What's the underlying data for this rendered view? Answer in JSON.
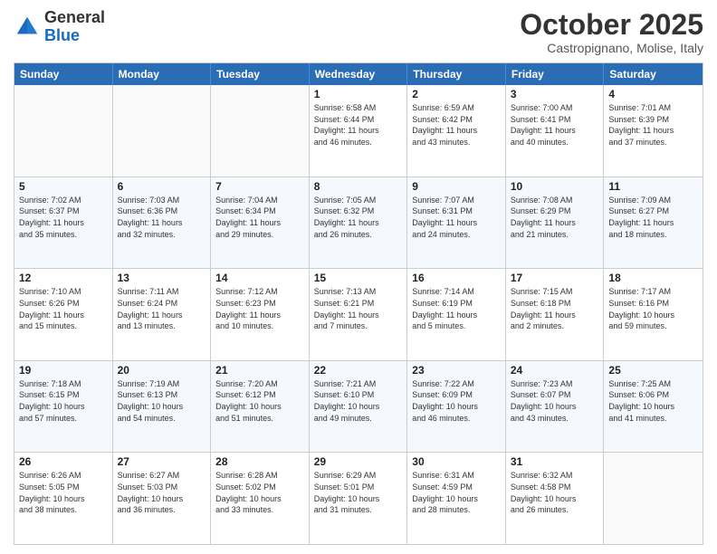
{
  "header": {
    "logo_line1": "General",
    "logo_line2": "Blue",
    "month_title": "October 2025",
    "location": "Castropignano, Molise, Italy"
  },
  "days_of_week": [
    "Sunday",
    "Monday",
    "Tuesday",
    "Wednesday",
    "Thursday",
    "Friday",
    "Saturday"
  ],
  "weeks": [
    [
      {
        "day": "",
        "info": ""
      },
      {
        "day": "",
        "info": ""
      },
      {
        "day": "",
        "info": ""
      },
      {
        "day": "1",
        "info": "Sunrise: 6:58 AM\nSunset: 6:44 PM\nDaylight: 11 hours\nand 46 minutes."
      },
      {
        "day": "2",
        "info": "Sunrise: 6:59 AM\nSunset: 6:42 PM\nDaylight: 11 hours\nand 43 minutes."
      },
      {
        "day": "3",
        "info": "Sunrise: 7:00 AM\nSunset: 6:41 PM\nDaylight: 11 hours\nand 40 minutes."
      },
      {
        "day": "4",
        "info": "Sunrise: 7:01 AM\nSunset: 6:39 PM\nDaylight: 11 hours\nand 37 minutes."
      }
    ],
    [
      {
        "day": "5",
        "info": "Sunrise: 7:02 AM\nSunset: 6:37 PM\nDaylight: 11 hours\nand 35 minutes."
      },
      {
        "day": "6",
        "info": "Sunrise: 7:03 AM\nSunset: 6:36 PM\nDaylight: 11 hours\nand 32 minutes."
      },
      {
        "day": "7",
        "info": "Sunrise: 7:04 AM\nSunset: 6:34 PM\nDaylight: 11 hours\nand 29 minutes."
      },
      {
        "day": "8",
        "info": "Sunrise: 7:05 AM\nSunset: 6:32 PM\nDaylight: 11 hours\nand 26 minutes."
      },
      {
        "day": "9",
        "info": "Sunrise: 7:07 AM\nSunset: 6:31 PM\nDaylight: 11 hours\nand 24 minutes."
      },
      {
        "day": "10",
        "info": "Sunrise: 7:08 AM\nSunset: 6:29 PM\nDaylight: 11 hours\nand 21 minutes."
      },
      {
        "day": "11",
        "info": "Sunrise: 7:09 AM\nSunset: 6:27 PM\nDaylight: 11 hours\nand 18 minutes."
      }
    ],
    [
      {
        "day": "12",
        "info": "Sunrise: 7:10 AM\nSunset: 6:26 PM\nDaylight: 11 hours\nand 15 minutes."
      },
      {
        "day": "13",
        "info": "Sunrise: 7:11 AM\nSunset: 6:24 PM\nDaylight: 11 hours\nand 13 minutes."
      },
      {
        "day": "14",
        "info": "Sunrise: 7:12 AM\nSunset: 6:23 PM\nDaylight: 11 hours\nand 10 minutes."
      },
      {
        "day": "15",
        "info": "Sunrise: 7:13 AM\nSunset: 6:21 PM\nDaylight: 11 hours\nand 7 minutes."
      },
      {
        "day": "16",
        "info": "Sunrise: 7:14 AM\nSunset: 6:19 PM\nDaylight: 11 hours\nand 5 minutes."
      },
      {
        "day": "17",
        "info": "Sunrise: 7:15 AM\nSunset: 6:18 PM\nDaylight: 11 hours\nand 2 minutes."
      },
      {
        "day": "18",
        "info": "Sunrise: 7:17 AM\nSunset: 6:16 PM\nDaylight: 10 hours\nand 59 minutes."
      }
    ],
    [
      {
        "day": "19",
        "info": "Sunrise: 7:18 AM\nSunset: 6:15 PM\nDaylight: 10 hours\nand 57 minutes."
      },
      {
        "day": "20",
        "info": "Sunrise: 7:19 AM\nSunset: 6:13 PM\nDaylight: 10 hours\nand 54 minutes."
      },
      {
        "day": "21",
        "info": "Sunrise: 7:20 AM\nSunset: 6:12 PM\nDaylight: 10 hours\nand 51 minutes."
      },
      {
        "day": "22",
        "info": "Sunrise: 7:21 AM\nSunset: 6:10 PM\nDaylight: 10 hours\nand 49 minutes."
      },
      {
        "day": "23",
        "info": "Sunrise: 7:22 AM\nSunset: 6:09 PM\nDaylight: 10 hours\nand 46 minutes."
      },
      {
        "day": "24",
        "info": "Sunrise: 7:23 AM\nSunset: 6:07 PM\nDaylight: 10 hours\nand 43 minutes."
      },
      {
        "day": "25",
        "info": "Sunrise: 7:25 AM\nSunset: 6:06 PM\nDaylight: 10 hours\nand 41 minutes."
      }
    ],
    [
      {
        "day": "26",
        "info": "Sunrise: 6:26 AM\nSunset: 5:05 PM\nDaylight: 10 hours\nand 38 minutes."
      },
      {
        "day": "27",
        "info": "Sunrise: 6:27 AM\nSunset: 5:03 PM\nDaylight: 10 hours\nand 36 minutes."
      },
      {
        "day": "28",
        "info": "Sunrise: 6:28 AM\nSunset: 5:02 PM\nDaylight: 10 hours\nand 33 minutes."
      },
      {
        "day": "29",
        "info": "Sunrise: 6:29 AM\nSunset: 5:01 PM\nDaylight: 10 hours\nand 31 minutes."
      },
      {
        "day": "30",
        "info": "Sunrise: 6:31 AM\nSunset: 4:59 PM\nDaylight: 10 hours\nand 28 minutes."
      },
      {
        "day": "31",
        "info": "Sunrise: 6:32 AM\nSunset: 4:58 PM\nDaylight: 10 hours\nand 26 minutes."
      },
      {
        "day": "",
        "info": ""
      }
    ]
  ]
}
